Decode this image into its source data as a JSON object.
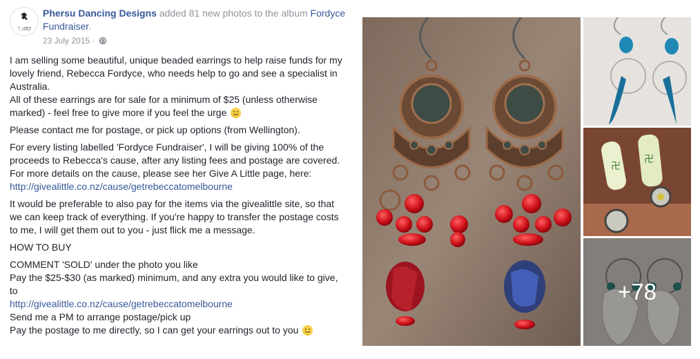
{
  "post": {
    "page_name": "Phersu Dancing Designs",
    "action_text": " added 81 new photos to the album ",
    "album_name": "Fordyce Fundraiser",
    "date": "23 July 2015",
    "separator": " · "
  },
  "body": {
    "p1": "I am selling some beautiful, unique beaded earrings to help raise funds for my lovely friend, Rebecca Fordyce, who needs help to go and see a specialist in Australia.",
    "p1b": "All of these earrings are for sale for a minimum of $25 (unless otherwise marked) - feel free to give more if you feel the urge",
    "p2": "Please contact me for postage, or pick up options (from Wellington).",
    "p3": "For every listing labelled 'Fordyce Fundraiser', I will be giving 100% of the proceeds to Rebecca's cause, after any listing fees and postage are covered.",
    "p3b": "For more details on the cause, please see her Give A Little page, here:",
    "link1": "http://givealittle.co.nz/cause/getrebeccatomelbourne",
    "p4": "It would be preferable to also pay for the items via the givealittle site, so that we can keep track of everything. If you're happy to transfer the postage costs to me, I will get them out to you - just flick me a message.",
    "how_heading": "HOW TO BUY",
    "step1": "COMMENT 'SOLD' under the photo you like",
    "step2": "Pay the $25-$30 (as marked) minimum, and any extra you would like to give, to",
    "link2": "http://givealittle.co.nz/cause/getrebeccatomelbourne",
    "step3": "Send me a PM to arrange postage/pick up",
    "step4": "Pay the postage to me directly, so I can get your earrings out to you"
  },
  "photos": {
    "more_count": "+78"
  },
  "colors": {
    "link": "#365899",
    "text": "#1d2129",
    "meta": "#90949c"
  }
}
